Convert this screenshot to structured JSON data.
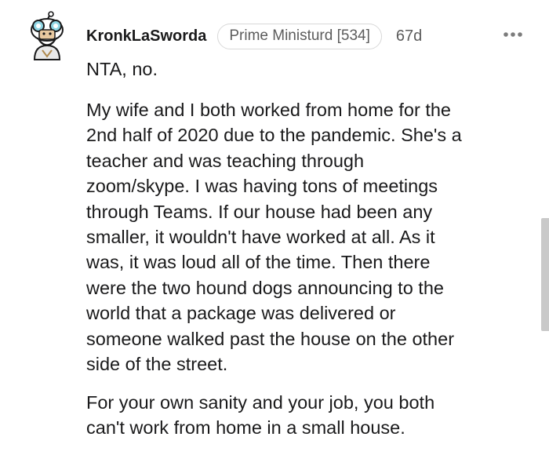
{
  "comment": {
    "author": "KronkLaSworda",
    "flair": "Prime Ministurd [534]",
    "age": "67d",
    "avatar_icon": "snoo-avatar-icon",
    "more_icon": "more-options-icon",
    "paragraphs": [
      "NTA, no.",
      "My wife and I both worked from home for the\n2nd half of 2020 due to the pandemic. She's a\nteacher and was teaching through\nzoom/skype. I was having tons of meetings\nthrough Teams. If our house had been any\nsmaller, it wouldn't have worked at all. As it\nwas, it was loud all of the time. Then there\nwere the two hound dogs announcing to the\nworld that a package was delivered or\nsomeone walked past the house on the other\nside of the street.",
      "For your own sanity and your job, you both\ncan't work from home in a small house."
    ]
  },
  "colors": {
    "text": "#1a1a1b",
    "meta": "#5c5c5c",
    "border": "#d8d8d8"
  }
}
